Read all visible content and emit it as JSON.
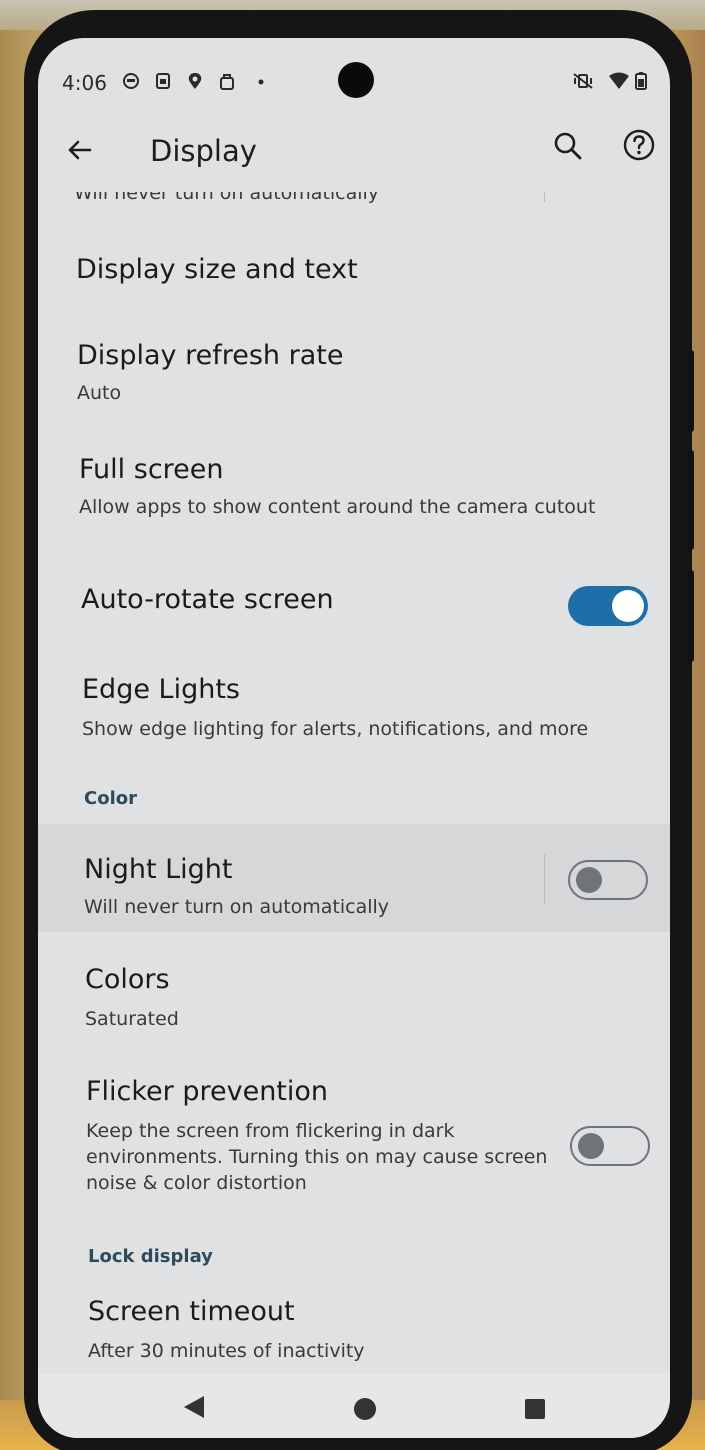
{
  "status_bar": {
    "time": "4:06",
    "icons": [
      "notification-icon",
      "sim-icon",
      "location-pin-icon",
      "bag-icon",
      "dot-icon"
    ],
    "right_icons": [
      "vibrate-off-icon",
      "wifi-icon",
      "battery-icon"
    ]
  },
  "app_bar": {
    "title": "Display",
    "back_icon": "arrow-back-icon",
    "search_icon": "search-icon",
    "help_icon": "help-icon"
  },
  "settings": {
    "partial_summary": "Will never turn on automatically",
    "display_size": {
      "title": "Display size and text"
    },
    "refresh_rate": {
      "title": "Display refresh rate",
      "summary": "Auto"
    },
    "full_screen": {
      "title": "Full screen",
      "summary": "Allow apps to show content around the camera cutout"
    },
    "auto_rotate": {
      "title": "Auto-rotate screen",
      "enabled": true
    },
    "edge_lights": {
      "title": "Edge Lights",
      "summary": "Show edge lighting for alerts, notifications, and more"
    },
    "color_header": "Color",
    "night_light": {
      "title": "Night Light",
      "summary": "Will never turn on automatically",
      "enabled": false
    },
    "colors": {
      "title": "Colors",
      "summary": "Saturated"
    },
    "flicker": {
      "title": "Flicker prevention",
      "summary_line1": "Keep the screen from flickering in dark",
      "summary_line2": "environments. Turning this on may cause screen",
      "summary_line3": "noise & color distortion",
      "enabled": false
    },
    "lock_header": "Lock display",
    "screen_timeout": {
      "title": "Screen timeout",
      "summary": "After 30 minutes of inactivity"
    }
  },
  "nav_bar": {
    "back": "nav-back-icon",
    "home": "nav-home-icon",
    "recents": "nav-recents-icon"
  },
  "colors": {
    "accent": "#1e6fa8",
    "section_header": "#2e4a5c",
    "background": "#e0e1e3"
  }
}
